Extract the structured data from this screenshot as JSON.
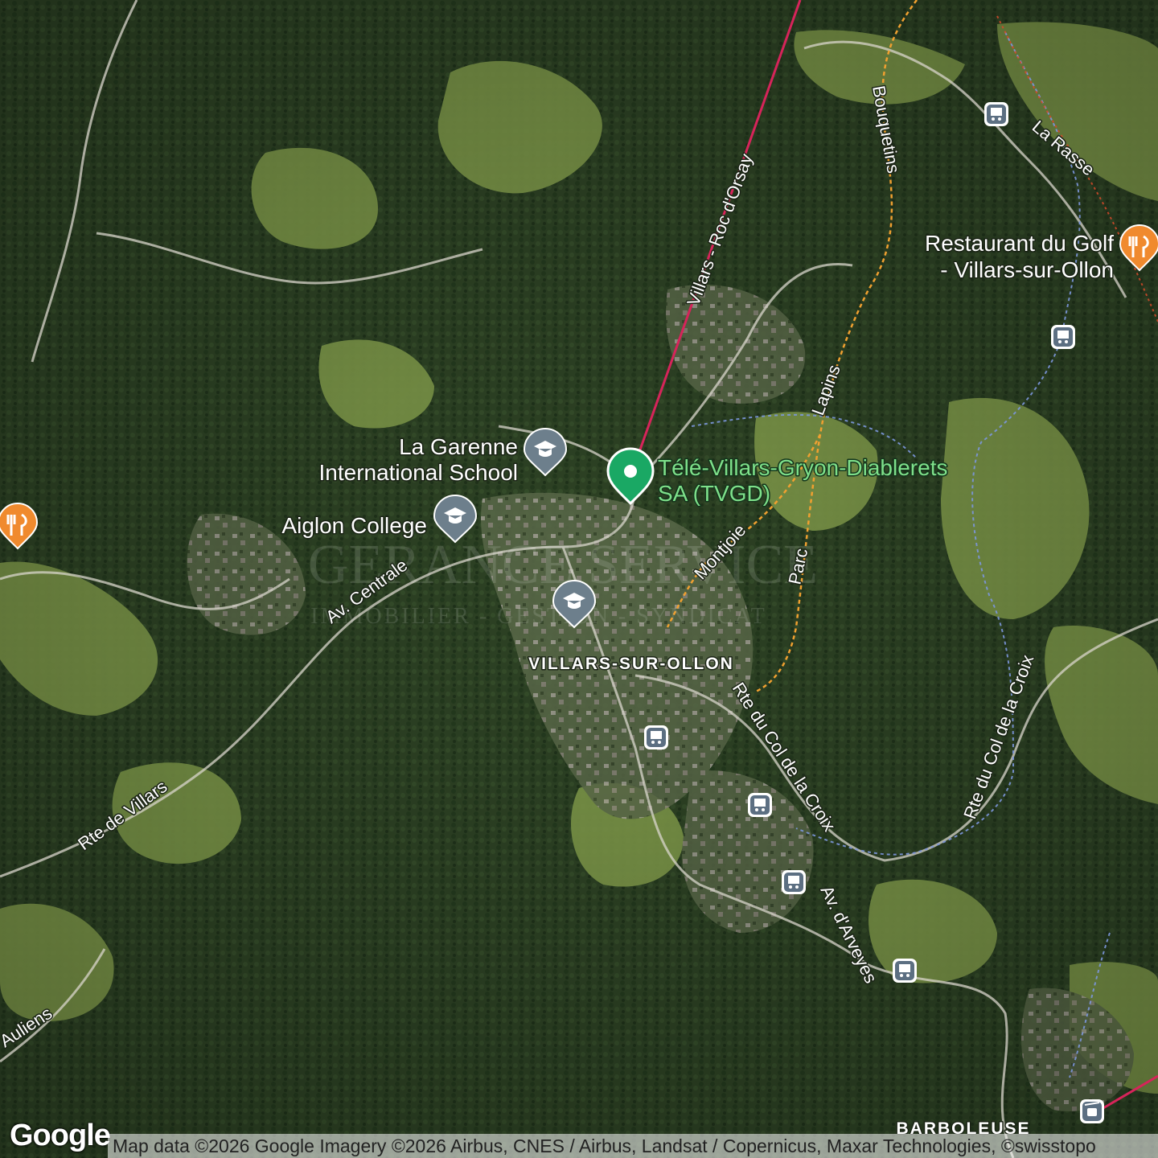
{
  "map": {
    "type": "satellite",
    "colors": {
      "forest": "#2f4426",
      "meadow": "#7f9a4a",
      "cable_car": "#d6245a",
      "trail_orange": "#f0a030",
      "trail_blue": "#6f8fd8",
      "poi_gray": "#6d7f8c",
      "poi_food": "#f08a2e",
      "poi_green": "#1aa864"
    }
  },
  "roads": {
    "villars_roc": "Villars - Roc d'Orsay",
    "bouquetins": "Bouquetins",
    "la_rasse": "La Rasse",
    "lapins": "Lapins",
    "montjoie": "Montjoie",
    "parc": "Parc",
    "av_centrale": "Av. Centrale",
    "rte_col_croix_1": "Rte du Col de la Croix",
    "rte_col_croix_2": "Rte du Col de la Croix",
    "av_arveyes": "Av. d'Arveyes",
    "rte_villars": "Rte de Villars",
    "auliens": "Auliens"
  },
  "places": {
    "villars": "VILLARS-SUR-OLLON",
    "barboleuse": "BARBOLEUSE"
  },
  "pois": {
    "restaurant_golf_line1": "Restaurant du Golf",
    "restaurant_golf_line2": "- Villars-sur-Ollon",
    "la_garenne_line1": "La Garenne",
    "la_garenne_line2": "International School",
    "aiglon": "Aiglon College",
    "tvgd_line1": "Télé-Villars-Gryon-Diablerets",
    "tvgd_line2": "SA (TVGD)"
  },
  "icons": {
    "food": "restaurant-icon",
    "school": "school-icon",
    "bus": "bus-stop-icon",
    "gondola": "cable-car-icon",
    "pin": "location-pin-icon"
  },
  "watermark": {
    "line1": "GERANCE SERVICE",
    "line2": "IMMOBILIER - GESTION - SYNDICAT"
  },
  "footer": {
    "logo": "Google",
    "attribution": "Map data ©2026 Google Imagery ©2026 Airbus, CNES / Airbus, Landsat / Copernicus, Maxar Technologies, ©swisstopo"
  }
}
